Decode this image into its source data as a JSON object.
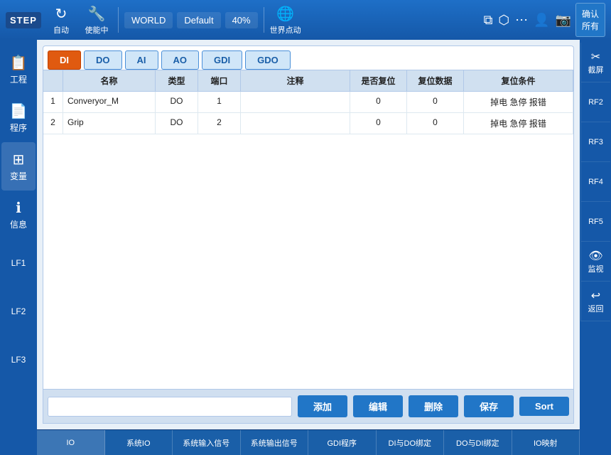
{
  "topbar": {
    "logo": "STEP",
    "btn1_label": "自动",
    "btn2_label": "使能中",
    "label_world": "WORLD",
    "label_default": "Default",
    "label_zoom": "40%",
    "label_move": "世界点动",
    "confirm_label": "确认\n所有"
  },
  "sidebar": {
    "items": [
      {
        "label": "工程",
        "icon": "☰"
      },
      {
        "label": "程序",
        "icon": "⊟"
      },
      {
        "label": "变量",
        "icon": "✕"
      },
      {
        "label": "信息",
        "icon": "ℹ"
      },
      {
        "label": "LF1",
        "icon": ""
      },
      {
        "label": "LF2",
        "icon": ""
      },
      {
        "label": "LF3",
        "icon": ""
      }
    ]
  },
  "tabs": {
    "active": "DO",
    "items": [
      "DI",
      "DO",
      "AI",
      "AO",
      "GDI",
      "GDO"
    ]
  },
  "table": {
    "headers": [
      "",
      "名称",
      "类型",
      "端口",
      "注释",
      "是否复位",
      "复位数据",
      "复位条件"
    ],
    "rows": [
      {
        "num": "1",
        "name": "Converyor_M",
        "type": "DO",
        "port": "1",
        "comment": "",
        "reset": "0",
        "reset_data": "0",
        "reset_cond": "掉电 急停 报错"
      },
      {
        "num": "2",
        "name": "Grip",
        "type": "DO",
        "port": "2",
        "comment": "",
        "reset": "0",
        "reset_data": "0",
        "reset_cond": "掉电 急停 报错"
      }
    ]
  },
  "actions": {
    "add": "添加",
    "edit": "编辑",
    "delete": "删除",
    "save": "保存",
    "sort": "Sort"
  },
  "bottom_tabs": {
    "items": [
      "IO",
      "系统IO",
      "系统输入信号",
      "系统输出信号",
      "GDI程序",
      "DI与DO绑定",
      "DO与DI绑定",
      "IO映射"
    ]
  },
  "right_sidebar": {
    "items": [
      {
        "label": "截屏",
        "icon": "✂"
      },
      {
        "label": "RF2",
        "icon": ""
      },
      {
        "label": "RF3",
        "icon": ""
      },
      {
        "label": "RF4",
        "icon": ""
      },
      {
        "label": "RF5",
        "icon": ""
      },
      {
        "label": "监视",
        "icon": "👁"
      },
      {
        "label": "返回",
        "icon": "↩"
      }
    ]
  }
}
